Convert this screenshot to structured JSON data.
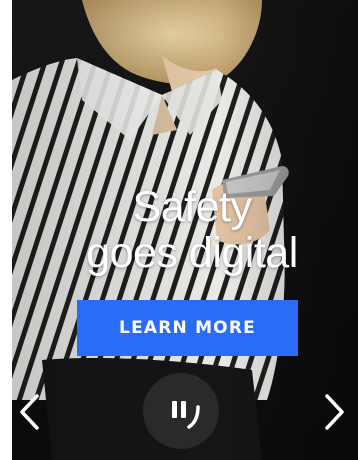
{
  "banner": {
    "headline_line1": "Safety",
    "headline_line2": "goes digital",
    "cta_label": "LEARN MORE",
    "cta_color": "#2a6cf5"
  },
  "controls": {
    "prev_icon": "chevron-left-icon",
    "next_icon": "chevron-right-icon",
    "pause_icon": "pause-icon"
  }
}
